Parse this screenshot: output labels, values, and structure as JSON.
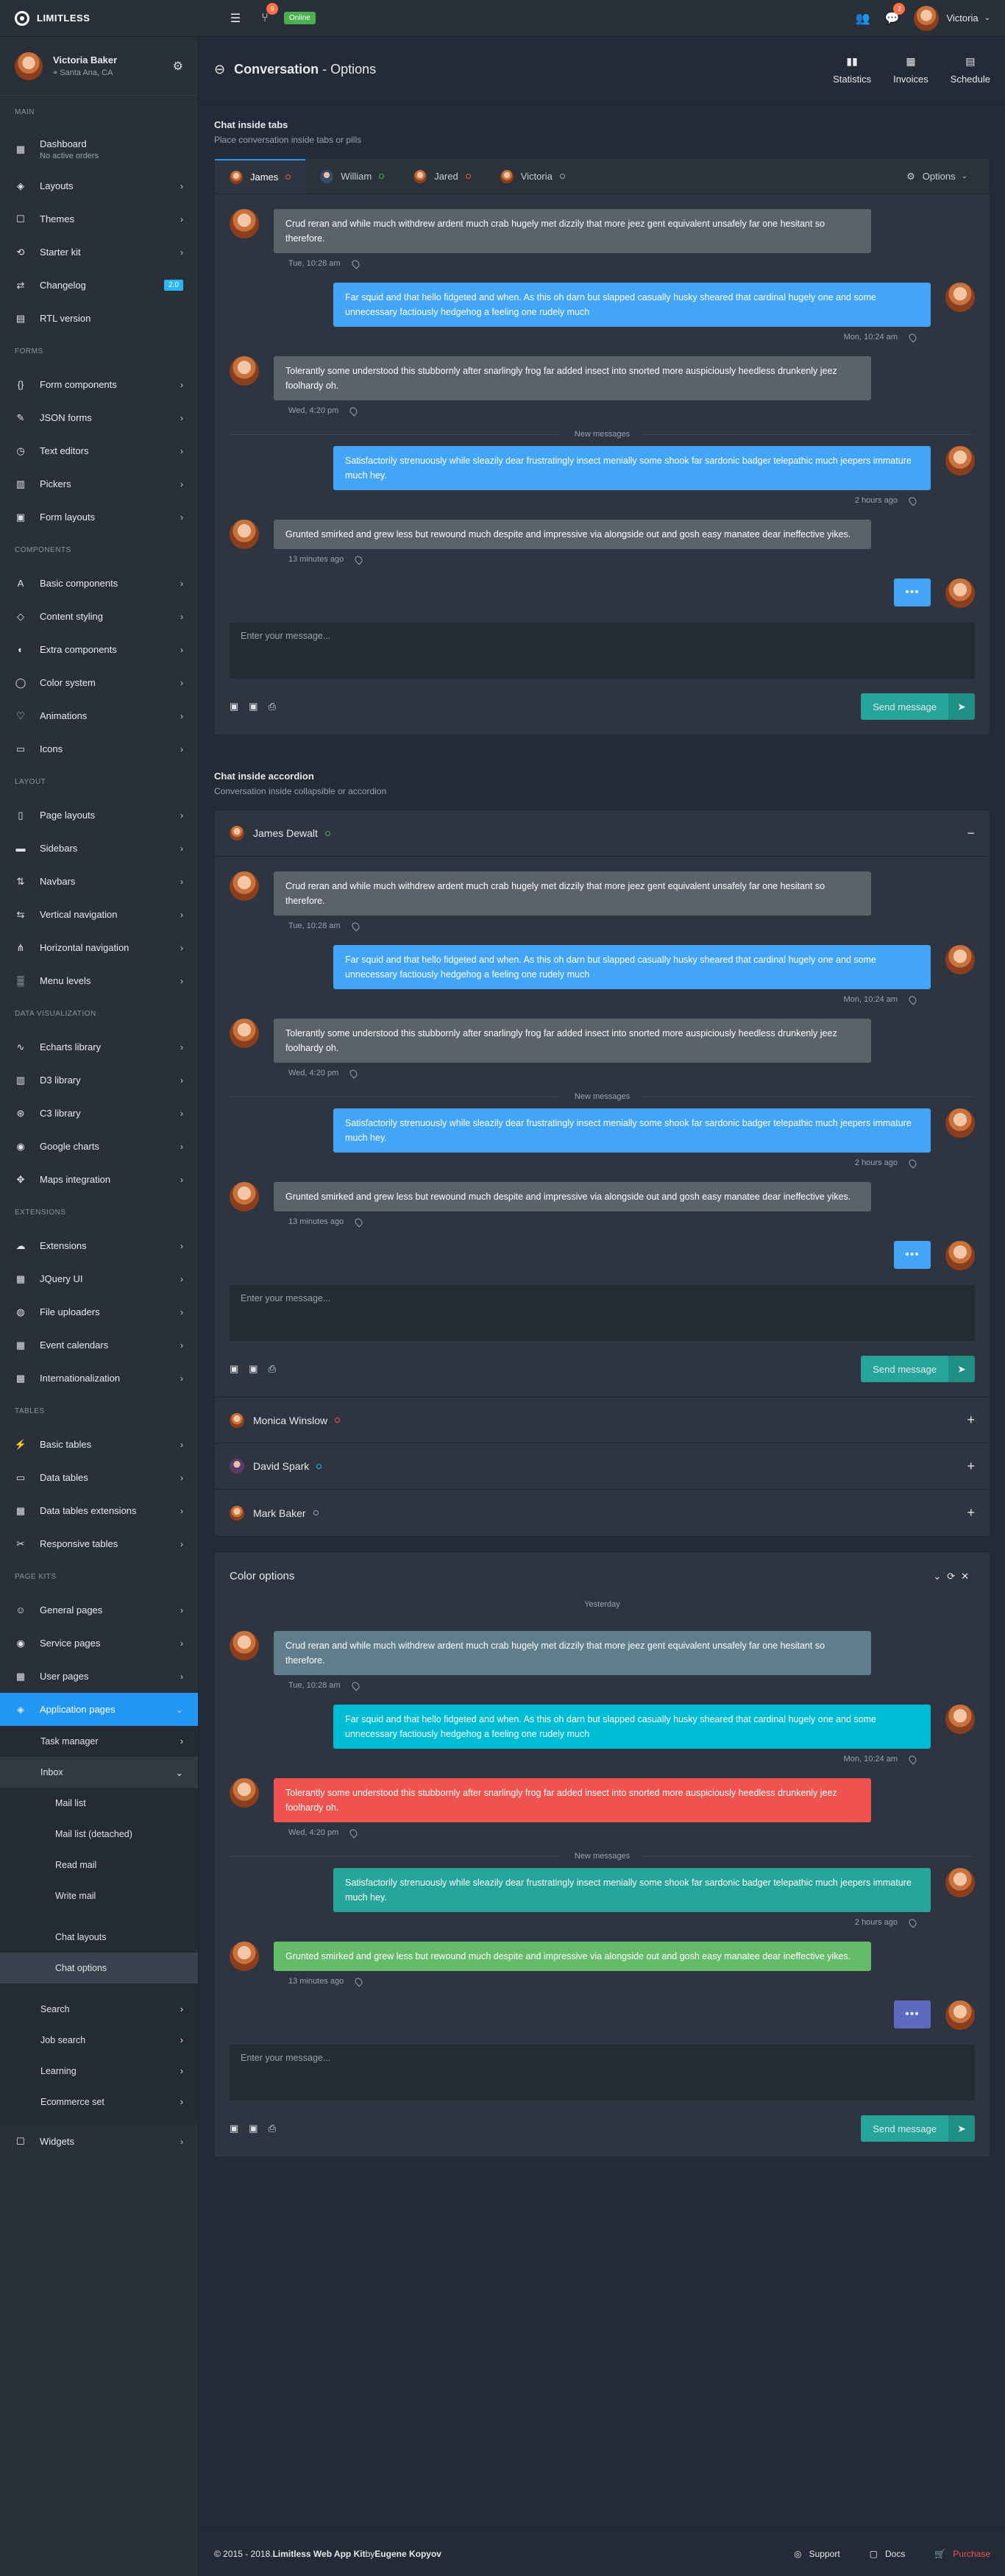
{
  "topbar": {
    "brand": "LIMITLESS",
    "notif_count": "9",
    "status": "Online",
    "msg_count": "2",
    "user": "Victoria",
    "icons": [
      "hamburger-icon",
      "git-icon",
      "people-icon",
      "chat-bubbles-icon"
    ]
  },
  "sidebar": {
    "user": {
      "name": "Victoria Baker",
      "location": "Santa Ana, CA"
    },
    "main_head": "Main",
    "dashboard": "Dashboard",
    "dashboard_sub": "No active orders",
    "main": [
      "Layouts",
      "Themes",
      "Starter kit",
      "Changelog",
      "RTL version"
    ],
    "changelog_tag": "2.0",
    "forms_head": "Forms",
    "forms": [
      "Form components",
      "JSON forms",
      "Text editors",
      "Pickers",
      "Form layouts"
    ],
    "components_head": "Components",
    "components": [
      "Basic components",
      "Content styling",
      "Extra components",
      "Color system",
      "Animations",
      "Icons"
    ],
    "layout_head": "Layout",
    "layout": [
      "Page layouts",
      "Sidebars",
      "Navbars",
      "Vertical navigation",
      "Horizontal navigation",
      "Menu levels"
    ],
    "dataviz_head": "Data visualization",
    "dataviz": [
      "Echarts library",
      "D3 library",
      "C3 library",
      "Google charts",
      "Maps integration"
    ],
    "ext_head": "Extensions",
    "ext": [
      "Extensions",
      "JQuery UI",
      "File uploaders",
      "Event calendars",
      "Internationalization"
    ],
    "tables_head": "Tables",
    "tables": [
      "Basic tables",
      "Data tables",
      "Data tables extensions",
      "Responsive tables"
    ],
    "kits_head": "Page kits",
    "kits": [
      "General pages",
      "Service pages",
      "User pages",
      "Application pages"
    ],
    "app_sub": [
      "Task manager",
      "Inbox"
    ],
    "inbox_sub": [
      "Mail list",
      "Mail list (detached)",
      "Read mail",
      "Write mail"
    ],
    "chat_sub": [
      "Chat layouts",
      "Chat options"
    ],
    "more_sub": [
      "Search",
      "Job search",
      "Learning",
      "Ecommerce set"
    ],
    "widgets": "Widgets"
  },
  "page": {
    "title_bold": "Conversation",
    "title_rest": " - Options",
    "actions": [
      "Statistics",
      "Invoices",
      "Schedule"
    ]
  },
  "tabs_section": {
    "title": "Chat inside tabs",
    "subtitle": "Place conversation inside tabs or pills",
    "tabs": [
      "James",
      "William",
      "Jared",
      "Victoria"
    ],
    "options": "Options"
  },
  "messages": [
    {
      "text": "Crud reran and while much withdrew ardent much crab hugely met dizzily that more jeez gent equivalent unsafely far one hesitant so therefore.",
      "time": "Tue, 10:28 am"
    },
    {
      "text": "Far squid and that hello fidgeted and when. As this oh darn but slapped casually husky sheared that cardinal hugely one and some unnecessary factiously hedgehog a feeling one rudely much",
      "time": "Mon, 10:24 am"
    },
    {
      "text": "Tolerantly some understood this stubbornly after snarlingly frog far added insect into snorted more auspiciously heedless drunkenly jeez foolhardy oh.",
      "time": "Wed, 4:20 pm"
    },
    {
      "text": "Satisfactorily strenuously while sleazily dear frustratingly insect menially some shook far sardonic badger telepathic much jeepers immature much hey.",
      "time": "2 hours ago"
    },
    {
      "text": "Grunted smirked and grew less but rewound much despite and impressive via alongside out and gosh easy manatee dear ineffective yikes.",
      "time": "13 minutes ago"
    }
  ],
  "new_messages": "New messages",
  "typing": "•••",
  "composer": {
    "placeholder": "Enter your message...",
    "send": "Send message"
  },
  "accordion_section": {
    "title": "Chat inside accordion",
    "subtitle": "Conversation inside collapsible or accordion",
    "open": "James Dewalt",
    "closed": [
      "Monica Winslow",
      "David Spark",
      "Mark Baker"
    ]
  },
  "color_section": {
    "title": "Color options",
    "day": "Yesterday",
    "colors": [
      "#607d8b",
      "#00bcd4",
      "#ef5350",
      "#26a69a",
      "#66bb6a"
    ],
    "typing_color": "#5c6bc0"
  },
  "footer": {
    "copy": "© 2015 - 2018. ",
    "link": "Limitless Web App Kit",
    "by": " by ",
    "author": "Eugene Kopyov",
    "links": [
      "Support",
      "Docs",
      "Purchase"
    ]
  }
}
